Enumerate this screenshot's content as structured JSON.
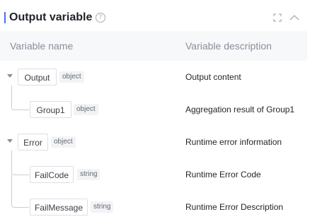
{
  "header": {
    "title": "Output variable",
    "help_icon": "question-circle-icon",
    "expand_icon": "expand-icon",
    "collapse_icon": "chevron-up-icon"
  },
  "columns": {
    "name": "Variable name",
    "description": "Variable description"
  },
  "rows": [
    {
      "name": "Output",
      "type": "object",
      "description": "Output content",
      "level": 0,
      "expanded": true
    },
    {
      "name": "Group1",
      "type": "object",
      "description": "Aggregation result of Group1",
      "level": 1
    },
    {
      "name": "Error",
      "type": "object",
      "description": "Runtime error information",
      "level": 0,
      "expanded": true
    },
    {
      "name": "FailCode",
      "type": "string",
      "description": "Runtime Error Code",
      "level": 1
    },
    {
      "name": "FailMessage",
      "type": "string",
      "description": "Runtime Error Description",
      "level": 1
    }
  ],
  "colors": {
    "accent": "#4e6ef2",
    "header_bg": "#f7f8fa",
    "tag_bg": "#f2f3f5"
  }
}
